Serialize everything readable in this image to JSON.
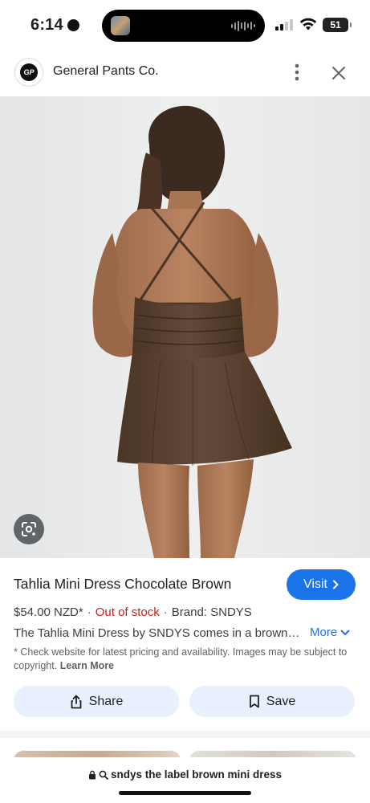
{
  "status": {
    "time": "6:14",
    "battery": "51"
  },
  "header": {
    "logo_text": "GP",
    "site_name": "General Pants Co."
  },
  "product": {
    "title": "Tahlia Mini Dress Chocolate Brown",
    "price": "$54.00 NZD*",
    "stock": "Out of stock",
    "brand": "Brand: SNDYS",
    "description": "The Tahlia Mini Dress by SNDYS comes in a brown…",
    "more_label": "More",
    "visit_label": "Visit",
    "disclaimer": "* Check website for latest pricing and availability. Images may be subject to copyright.",
    "learn_more": "Learn More"
  },
  "actions": {
    "share_label": "Share",
    "save_label": "Save"
  },
  "url_bar": {
    "query": "sndys the label brown mini dress"
  },
  "colors": {
    "accent": "#1a73e8",
    "out_of_stock": "#c5221f",
    "chip_bg": "#e8f0fe",
    "dress": "#5b4333"
  },
  "icons": [
    "more-vert-icon",
    "close-icon",
    "google-lens-icon",
    "chevron-right-icon",
    "chevron-down-icon",
    "share-icon",
    "bookmark-icon",
    "lock-icon",
    "search-icon"
  ]
}
